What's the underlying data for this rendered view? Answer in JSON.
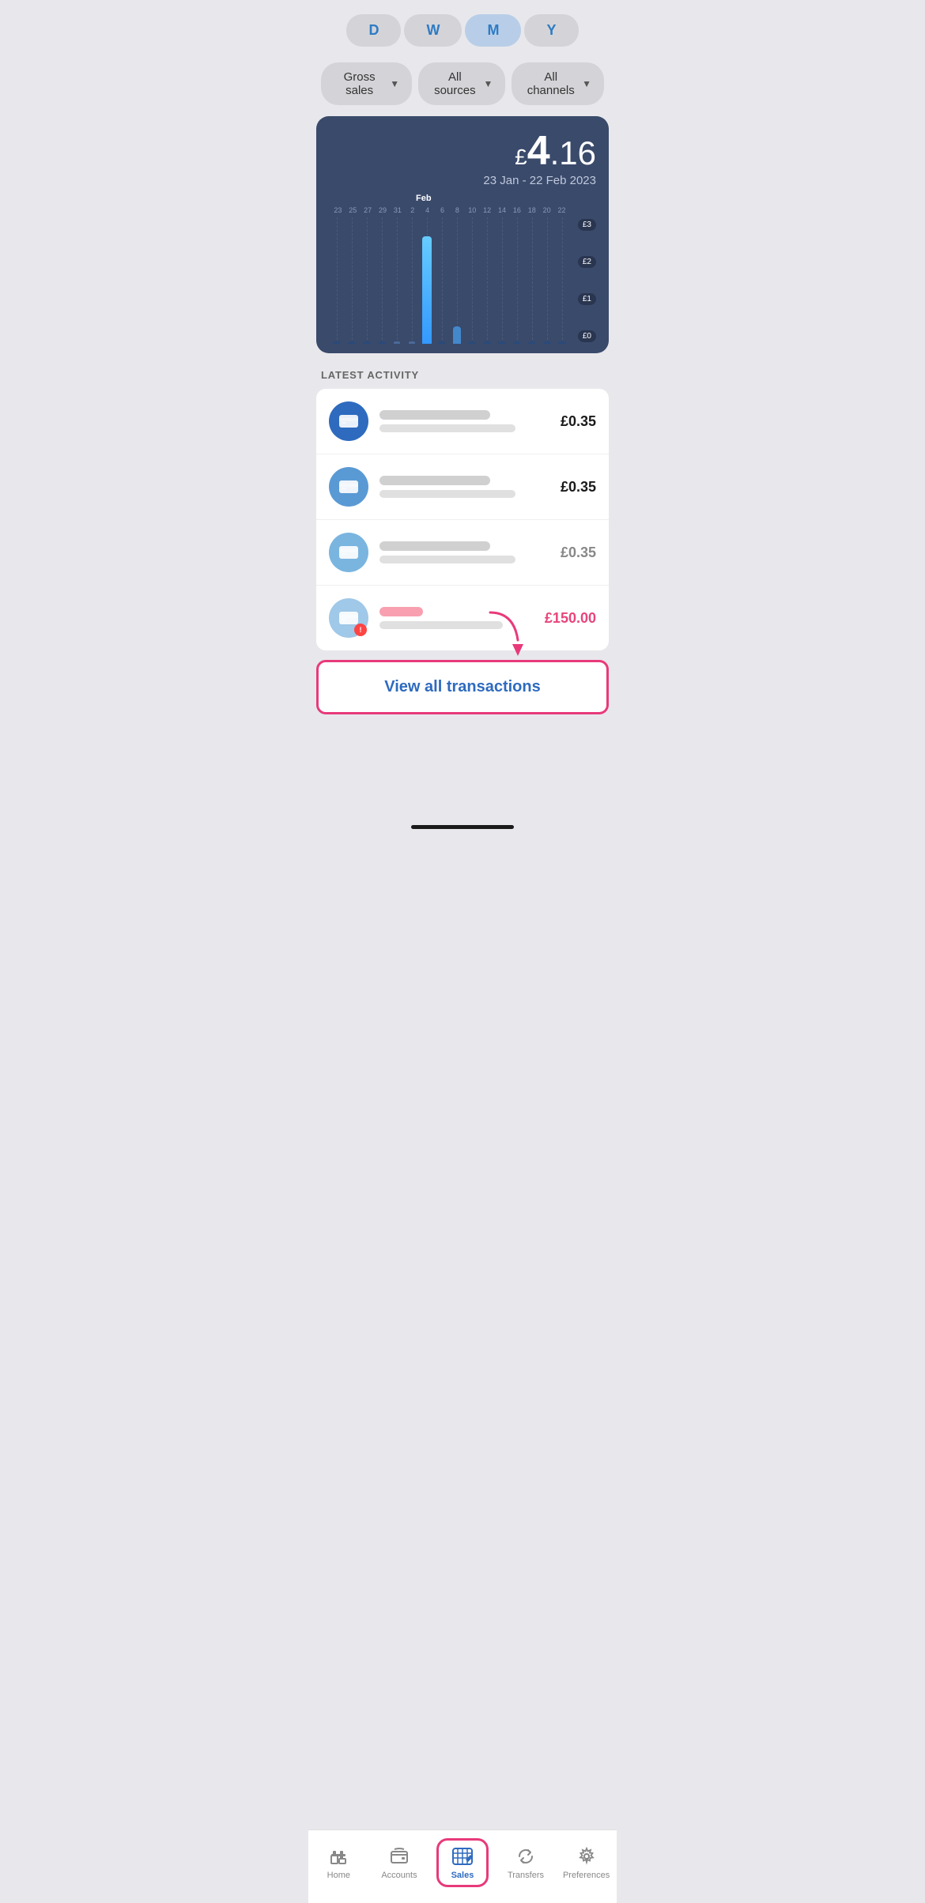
{
  "period": {
    "options": [
      "D",
      "W",
      "M",
      "Y"
    ],
    "active": "M"
  },
  "filters": {
    "type": {
      "label": "Gross sales",
      "icon": "chevron-down"
    },
    "source": {
      "label": "All sources",
      "icon": "chevron-down"
    },
    "channel": {
      "label": "All channels",
      "icon": "chevron-down"
    }
  },
  "chart": {
    "total": "£4.16",
    "total_pound": "£",
    "total_number": "4",
    "total_decimal": ".16",
    "date_range": "23 Jan - 22 Feb 2023",
    "x_labels": [
      "23",
      "25",
      "27",
      "29",
      "31",
      "Feb",
      "2",
      "4",
      "6",
      "8",
      "10",
      "12",
      "14",
      "16",
      "18",
      "20",
      "22"
    ],
    "y_labels": [
      "£3",
      "£2",
      "£1",
      "£0"
    ]
  },
  "latest_activity": {
    "title": "LATEST ACTIVITY",
    "transactions": [
      {
        "amount": "£0.35",
        "type": "normal"
      },
      {
        "amount": "£0.35",
        "type": "normal"
      },
      {
        "amount": "£0.35",
        "type": "normal"
      },
      {
        "amount": "£150.00",
        "type": "negative"
      }
    ]
  },
  "view_all_btn": "View all transactions",
  "nav": {
    "items": [
      {
        "label": "Home",
        "icon": "home-icon",
        "active": false
      },
      {
        "label": "Accounts",
        "icon": "wallet-icon",
        "active": false
      },
      {
        "label": "Sales",
        "icon": "sales-icon",
        "active": true,
        "highlighted": true
      },
      {
        "label": "Transfers",
        "icon": "transfers-icon",
        "active": false
      },
      {
        "label": "Preferences",
        "icon": "gear-icon",
        "active": false
      }
    ]
  }
}
